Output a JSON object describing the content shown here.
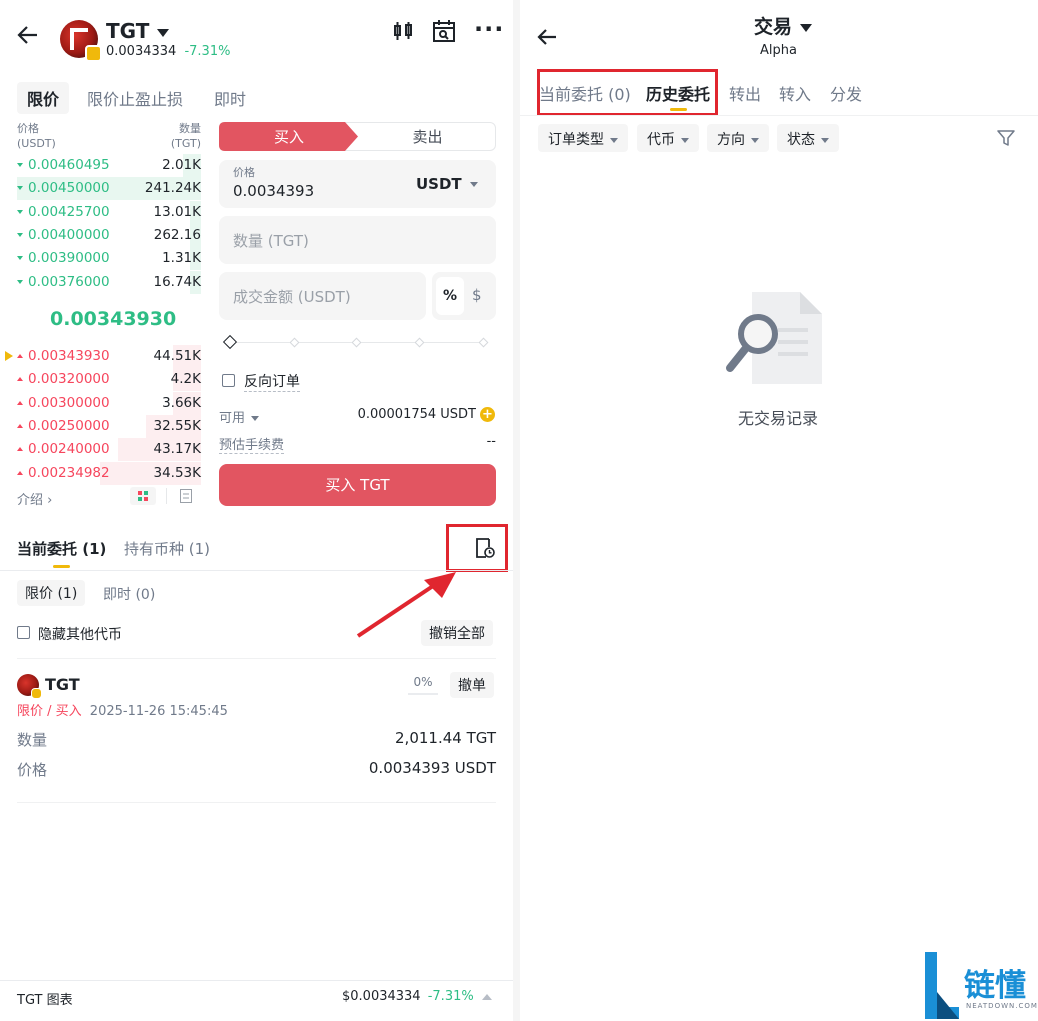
{
  "left": {
    "header": {
      "token": "TGT",
      "price": "0.0034334",
      "change": "-7.31%"
    },
    "order_tabs": [
      "限价",
      "限价止盈止损",
      "即时"
    ],
    "book_head": {
      "price_label": "价格",
      "price_unit": "(USDT)",
      "qty_label": "数量",
      "qty_unit": "(TGT)"
    },
    "bids": [
      {
        "price": "0.00460495",
        "qty": "2.01K",
        "depth": 0.1
      },
      {
        "price": "0.00450000",
        "qty": "241.24K",
        "depth": 1.0
      },
      {
        "price": "0.00425700",
        "qty": "13.01K",
        "depth": 0.06
      },
      {
        "price": "0.00400000",
        "qty": "262.16",
        "depth": 0.06
      },
      {
        "price": "0.00390000",
        "qty": "1.31K",
        "depth": 0.06
      },
      {
        "price": "0.00376000",
        "qty": "16.74K",
        "depth": 0.06
      }
    ],
    "mid_price": "0.00343930",
    "asks": [
      {
        "price": "0.00343930",
        "qty": "44.51K",
        "depth": 0.15
      },
      {
        "price": "0.00320000",
        "qty": "4.2K",
        "depth": 0.15
      },
      {
        "price": "0.00300000",
        "qty": "3.66K",
        "depth": 0.15
      },
      {
        "price": "0.00250000",
        "qty": "32.55K",
        "depth": 0.3
      },
      {
        "price": "0.00240000",
        "qty": "43.17K",
        "depth": 0.45
      },
      {
        "price": "0.00234982",
        "qty": "34.53K",
        "depth": 0.55
      }
    ],
    "intro": "介绍",
    "form": {
      "buy": "买入",
      "sell": "卖出",
      "price_label": "价格",
      "price_value": "0.0034393",
      "quote": "USDT",
      "qty_placeholder": "数量 (TGT)",
      "amount_placeholder": "成交金额 (USDT)",
      "percent": "%",
      "dollar": "$",
      "reverse": "反向订单",
      "available_label": "可用",
      "available_value": "0.00001754 USDT",
      "fee_label": "预估手续费",
      "fee_value": "--",
      "submit": "买入 TGT"
    },
    "orders": {
      "tab_open": "当前委托 (1)",
      "tab_holdings": "持有币种 (1)",
      "sub_limit": "限价 (1)",
      "sub_instant": "即时 (0)",
      "hide_others": "隐藏其他代币",
      "cancel_all": "撤销全部",
      "order": {
        "token": "TGT",
        "fill": "0%",
        "cancel": "撤单",
        "type": "限价 / 买入",
        "time": "2025-11-26 15:45:45",
        "qty_label": "数量",
        "qty_value": "2,011.44 TGT",
        "price_label": "价格",
        "price_value": "0.0034393 USDT"
      }
    },
    "footer": {
      "label": "TGT 图表",
      "price": "$0.0034334",
      "change": "-7.31%"
    }
  },
  "right": {
    "title": "交易",
    "subtitle": "Alpha",
    "tabs": [
      "当前委托 (0)",
      "历史委托",
      "转出",
      "转入",
      "分发"
    ],
    "filters": [
      "订单类型",
      "代币",
      "方向",
      "状态"
    ],
    "empty": "无交易记录"
  },
  "watermark": {
    "name": "链懂",
    "site": "NEATDOWN.COM"
  },
  "colors": {
    "buy": "#e25561",
    "up": "#2ebd85",
    "down": "#f6465d",
    "accent": "#f0b90b",
    "highlight": "#e0262f"
  }
}
